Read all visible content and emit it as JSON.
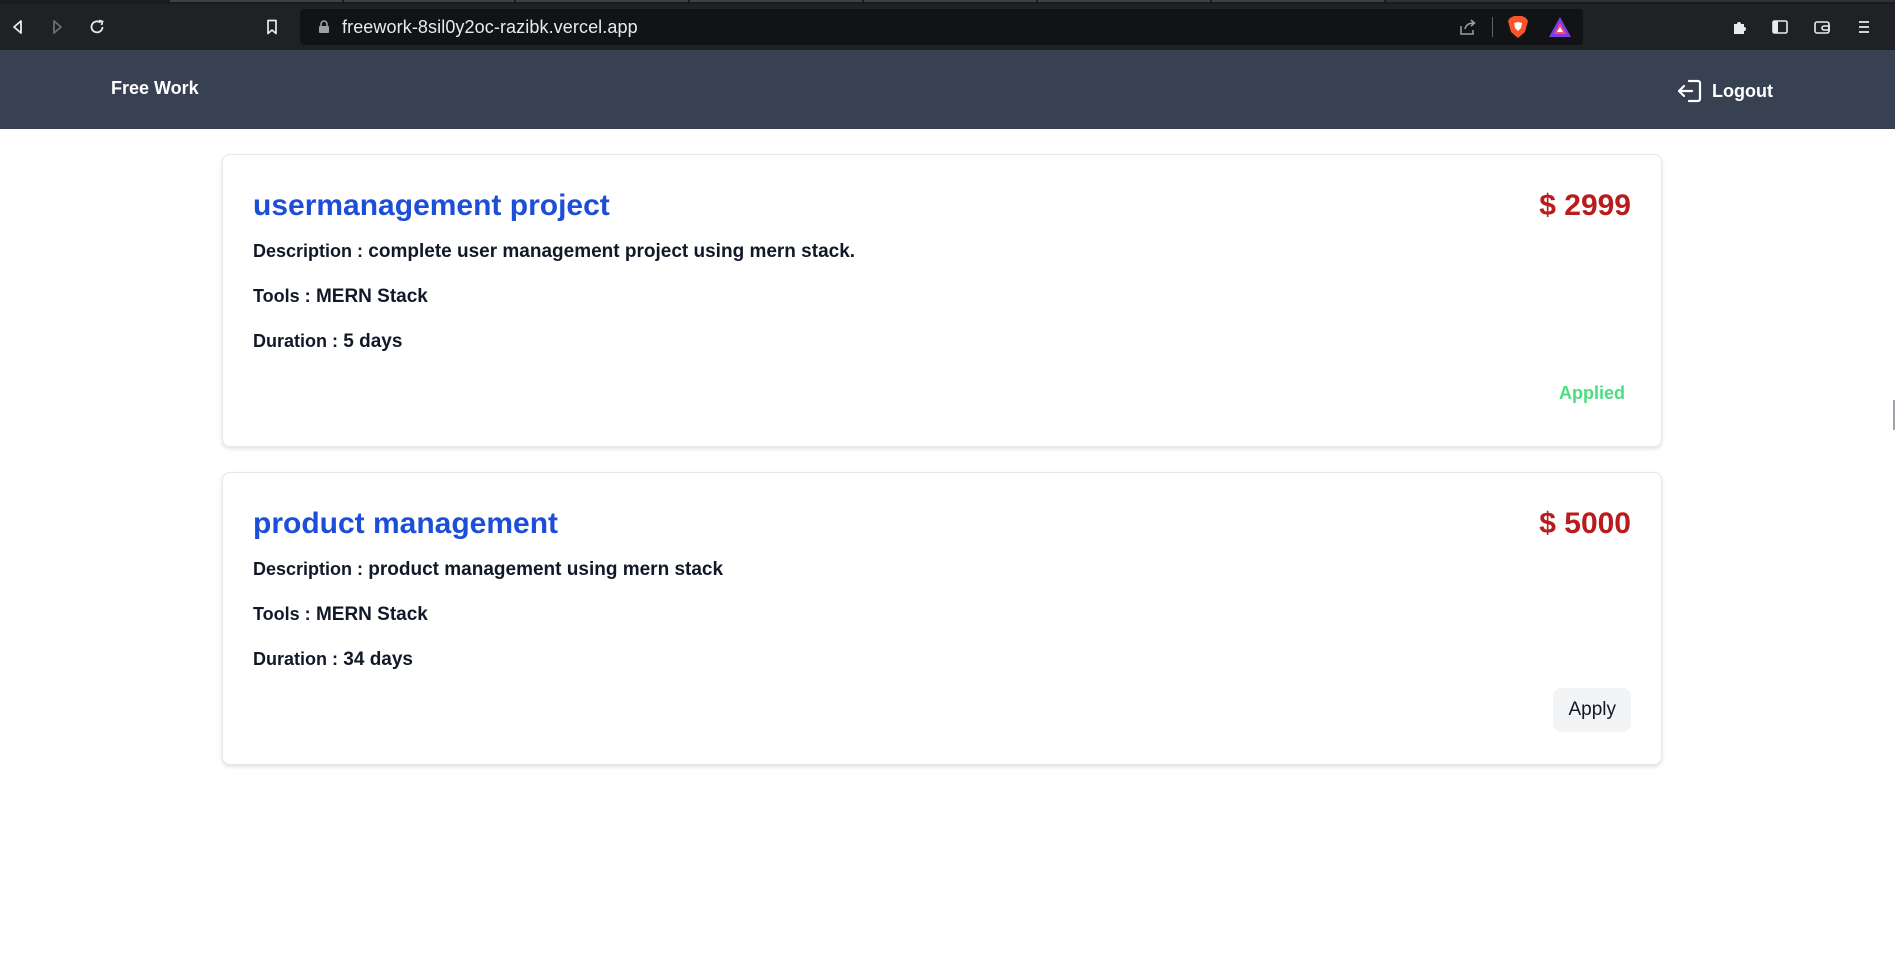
{
  "browser": {
    "url": "freework-8sil0y2oc-razibk.vercel.app"
  },
  "navbar": {
    "brand": "Free Work",
    "logout_label": "Logout"
  },
  "projects": [
    {
      "title": "usermanagement project",
      "price": "$ 2999",
      "description_label": "Description :",
      "description": "complete user management project using mern stack.",
      "tools_label": "Tools :",
      "tools": "MERN Stack",
      "duration_label": "Duration :",
      "duration": "5 days",
      "status": "Applied"
    },
    {
      "title": "product management",
      "price": "$ 5000",
      "description_label": "Description :",
      "description": "product management using mern stack",
      "tools_label": "Tools :",
      "tools": "MERN Stack",
      "duration_label": "Duration :",
      "duration": "34 days",
      "action": "Apply"
    }
  ],
  "colors": {
    "navbar_bg": "#374151",
    "title": "#1d4ed8",
    "price": "#b91c1c",
    "applied": "#4ade80"
  }
}
